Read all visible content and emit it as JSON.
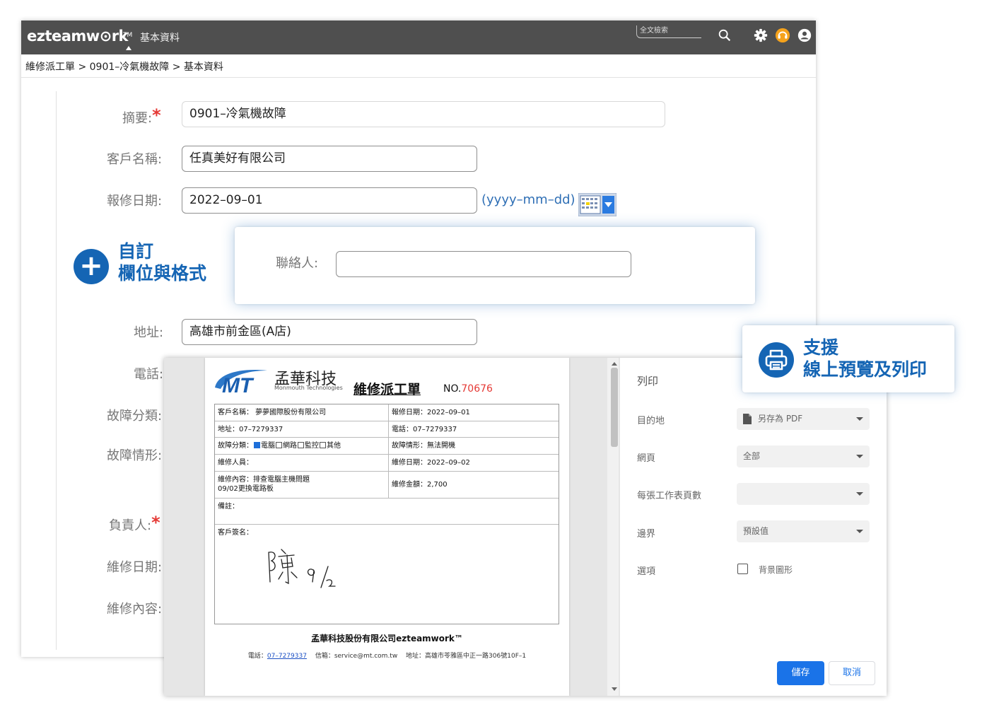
{
  "app": {
    "logo": "ezteamw",
    "logo_rest": "rk",
    "logo_tm": "TM",
    "module_title": "基本資料",
    "search_placeholder": "全文檢索"
  },
  "breadcrumb": "維修派工單  >  0901–冷氣機故障  >  基本資料",
  "form": {
    "summary_label": "摘要:",
    "summary_value": "0901–冷氣機故障",
    "customer_label": "客戶名稱:",
    "customer_value": "任真美好有限公司",
    "report_date_label": "報修日期:",
    "report_date_value": "2022–09–01",
    "date_hint": "(yyyy–mm–dd)",
    "address_label": "地址:",
    "address_value": "高雄市前金區(A店)",
    "phone_label": "電話:",
    "fault_cat_label": "故障分類:",
    "fault_desc_label": "故障情形:",
    "owner_label": "負責人:",
    "repair_date_label": "維修日期:",
    "repair_content_label": "維修內容:",
    "required_mark": "*"
  },
  "custom_field_card": {
    "contact_label": "聯絡人:",
    "contact_value": ""
  },
  "feature_custom": {
    "line1": "自訂",
    "line2": "欄位與格式"
  },
  "feature_print": {
    "line1": "支援",
    "line2": "線上預覽及列印"
  },
  "document": {
    "company_cn": "孟華科技",
    "company_en": "Monmouth Technologies",
    "title": "維修派工單",
    "no_label": "NO.",
    "no_value": "70676",
    "customer": "客戶名稱： 夢夢國際股份有限公司",
    "report_date": "報修日期：2022–09–01",
    "address": "地址：07–7279337",
    "phone": "電話：07–7279337",
    "fault_cat_prefix": "故障分類：",
    "fault_opt_1": "電腦",
    "fault_opt_2": "網路",
    "fault_opt_3": "監控",
    "fault_opt_4": "其他",
    "fault_desc": "故障情形：無法開機",
    "technician": "維修人員：",
    "repair_date": "維修日期：2022–09–02",
    "repair_content_1": "維修內容：排查電腦主機問題",
    "repair_content_2": "09/02更換電路板",
    "repair_amount": "維修金額：2,700",
    "note": "備註：",
    "signature_label": "客戶簽名：",
    "footer_company": "孟華科技股份有限公司ezteamwork™",
    "footer_phone_label": "電話：",
    "footer_phone": "07–7279337",
    "footer_rest": "信箱：service@mt.com.tw　 地址：高雄市苓雅區中正一路306號10F–1"
  },
  "print_panel": {
    "title": "列印",
    "destination_label": "目的地",
    "destination_value": "另存為 PDF",
    "pages_label": "網頁",
    "pages_value": "全部",
    "pages_per_sheet_label": "每張工作表頁數",
    "pages_per_sheet_value": "",
    "margins_label": "邊界",
    "margins_value": "預設值",
    "options_label": "選項",
    "background_label": "背景圖形",
    "save_label": "儲存",
    "cancel_label": "取消"
  },
  "colors": {
    "topbar": "#4f4f4f",
    "accent_blue": "#1565b4",
    "required_red": "#e53935",
    "print_button_blue": "#1a73e8"
  },
  "icons": [
    "search-icon",
    "gear-icon",
    "support-icon",
    "user-icon",
    "calendar-icon",
    "plus-icon",
    "printer-icon",
    "file-icon"
  ]
}
